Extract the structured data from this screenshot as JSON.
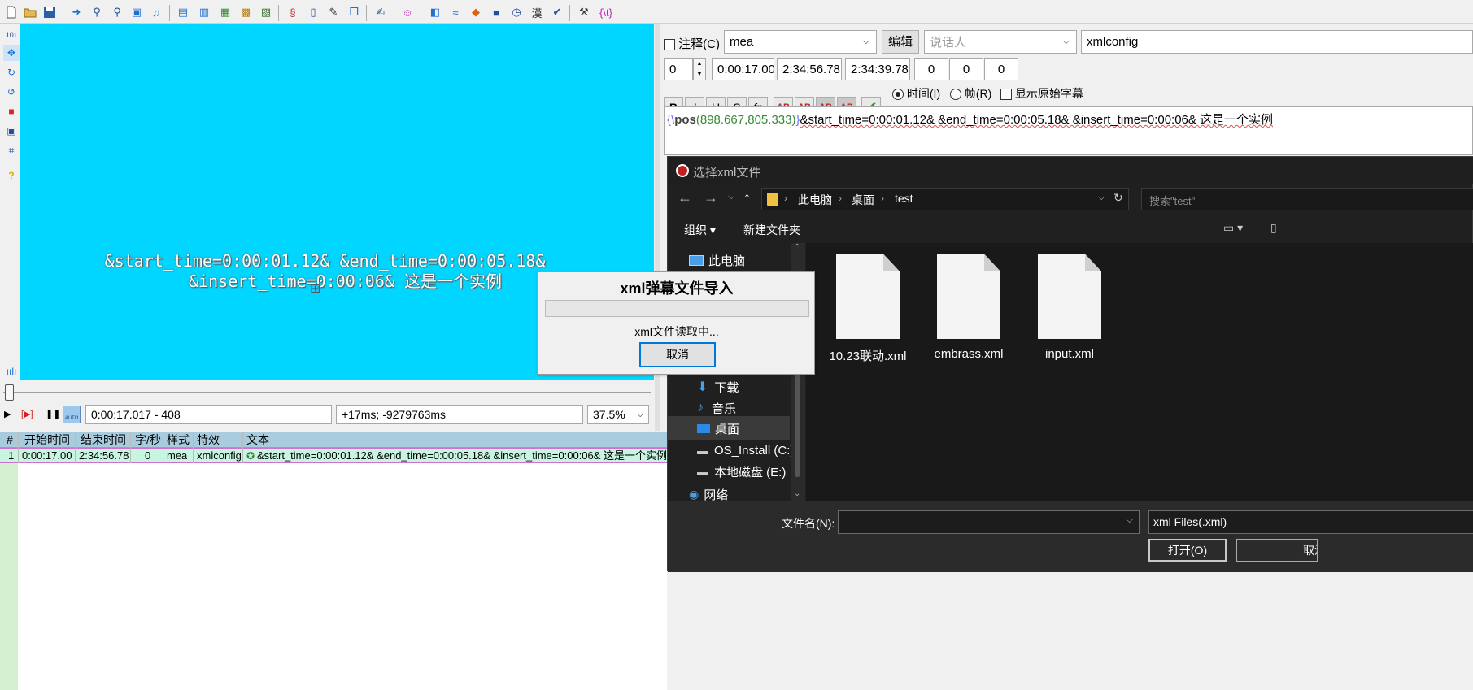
{
  "toolbar": {
    "icons": [
      "new-file-icon",
      "open-folder-icon",
      "save-icon",
      "jump-icon",
      "zoom-in-icon",
      "zoom-out-icon",
      "video-icon",
      "audio-icon",
      "styles-icon",
      "properties-icon",
      "film-icon",
      "film-strip-icon",
      "frame-icon",
      "script-icon",
      "notes-icon",
      "pencil-icon",
      "copy-icon",
      "spellcheck-icon",
      "face-icon",
      "marker-icon",
      "wave-icon",
      "fish-icon",
      "stop-icon",
      "timer-icon",
      "kanji-icon",
      "check-icon",
      "tools-icon"
    ],
    "tag_label": "{\\t}"
  },
  "left_tools": [
    "ruler-icon",
    "move-icon",
    "rotate-z-icon",
    "rotate-xy-icon",
    "scale-icon",
    "clip-icon",
    "vector-clip-icon",
    "help-icon",
    "audio-wave-icon"
  ],
  "video": {
    "background": "#00d6ff",
    "subtitle_line1": "&start_time=0:00:01.12& &end_time=0:00:05.18&",
    "subtitle_line2": "&insert_time=0:00:06& 这是一个实例"
  },
  "playback": {
    "time_display": "0:00:17.017 - 408",
    "offset_display": "+17ms; -9279763ms",
    "zoom": "37.5%",
    "auto_label": "AUTO"
  },
  "grid": {
    "headers": [
      "#",
      "开始时间",
      "结束时间",
      "字/秒",
      "样式",
      "特效",
      "文本"
    ],
    "rows": [
      {
        "num": "1",
        "start": "0:00:17.00",
        "end": "2:34:56.78",
        "cps": "0",
        "style": "mea",
        "effect": "xmlconfig",
        "text": "&start_time=0:00:01.12& &end_time=0:00:05.18& &insert_time=0:00:06& 这是一个实例"
      }
    ]
  },
  "edit_panel": {
    "comment_label": "注释(C)",
    "style_value": "mea",
    "edit_button": "编辑",
    "actor_placeholder": "说话人",
    "effect_value": "xmlconfig",
    "layer": "0",
    "start_time": "0:00:17.00",
    "end_time": "2:34:56.78",
    "duration": "2:34:39.78",
    "margin_l": "0",
    "margin_r": "0",
    "margin_v": "0",
    "format_buttons": [
      "B",
      "I",
      "U",
      "S",
      "fn",
      "AB",
      "AB",
      "AB",
      "AB"
    ],
    "time_radio": "时间(I)",
    "frame_radio": "帧(R)",
    "show_original": "显示原始字幕",
    "text_tag_open": "{\\",
    "text_tag_name": "pos",
    "text_tag_args": "(898.667,805.333)",
    "text_tag_close": "}",
    "text_body": "&start_time=0:00:01.12& &end_time=0:00:05.18& &insert_time=0:00:06& 这是一个实例"
  },
  "file_dialog": {
    "title": "选择xml文件",
    "breadcrumb": [
      "此电脑",
      "桌面",
      "test"
    ],
    "search_placeholder": "搜索\"test\"",
    "organize": "组织 ▾",
    "new_folder": "新建文件夹",
    "nav_items": [
      "此电脑",
      "下载",
      "音乐",
      "桌面",
      "OS_Install (C:)",
      "本地磁盘 (E:)",
      "网络"
    ],
    "files": [
      "10.23联动.xml",
      "embrass.xml",
      "input.xml"
    ],
    "filename_label": "文件名(N):",
    "filename_value": "",
    "filter_value": "xml Files(.xml)",
    "open_button": "打开(O)",
    "cancel_button": "取消"
  },
  "progress_dialog": {
    "title": "xml弹幕文件导入",
    "status": "xml文件读取中...",
    "cancel": "取消",
    "progress": 0
  }
}
